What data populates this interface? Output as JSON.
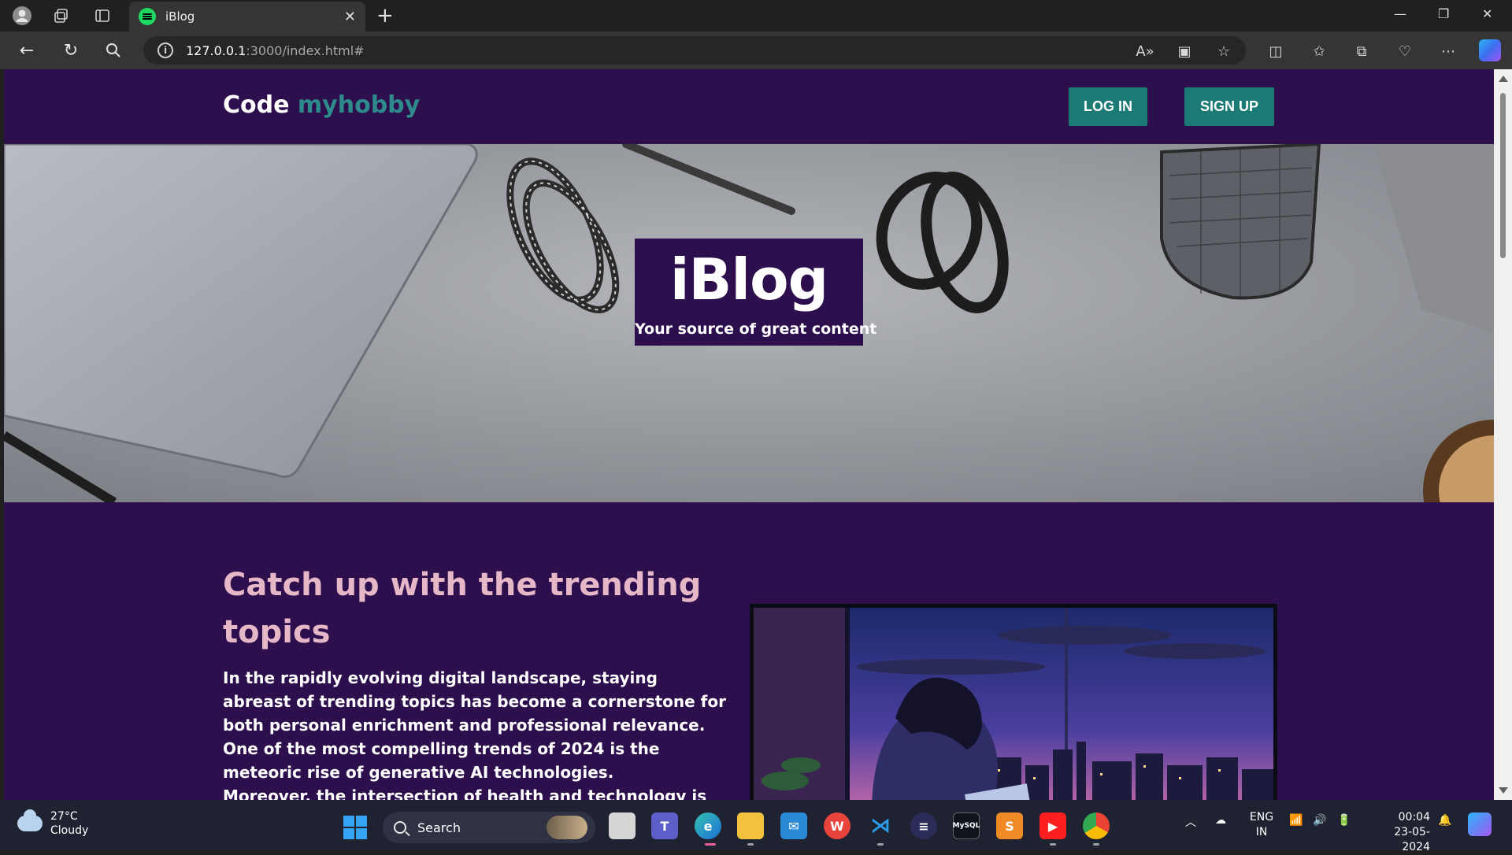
{
  "browser": {
    "tab_title": "iBlog",
    "url_host": "127.0.0.1",
    "url_path": ":3000/index.html#"
  },
  "site": {
    "logo_main": "Code ",
    "logo_accent": "myhobby",
    "login_label": "LOG IN",
    "signup_label": "SIGN UP",
    "hero_title": "iBlog",
    "hero_subtitle": "Your source of great content",
    "section_heading": "Catch up with the trending topics",
    "paragraph_1": "In the rapidly evolving digital landscape, staying abreast of trending topics has become a cornerstone for both personal enrichment and professional relevance. One of the most compelling trends of 2024 is the meteoric rise of generative AI technologies.",
    "paragraph_2": "Moreover, the intersection of health and technology is"
  },
  "taskbar": {
    "weather_temp": "27°C",
    "weather_desc": "Cloudy",
    "search_label": "Search",
    "lang_1": "ENG",
    "lang_2": "IN",
    "time": "00:04",
    "date": "23-05-2024"
  },
  "colors": {
    "page_purple": "#2d0f4e",
    "accent_teal": "#1c7a75",
    "heading_pink": "#e6b7c6"
  }
}
